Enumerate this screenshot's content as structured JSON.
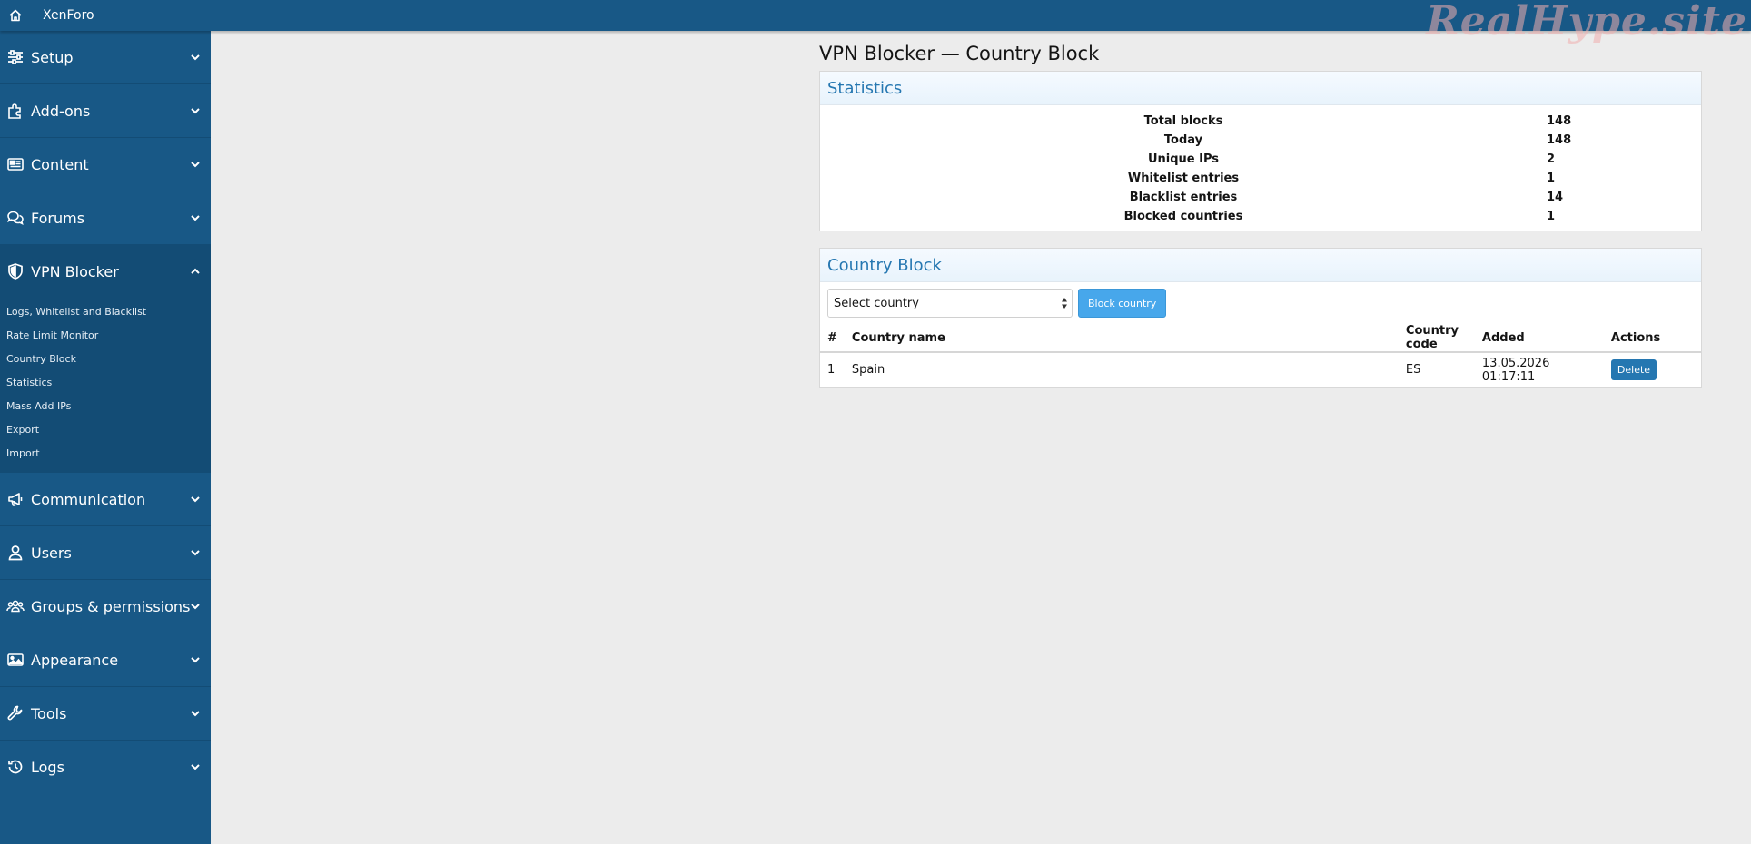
{
  "topbar": {
    "brand": "XenForo",
    "watermark": "RealHype.site"
  },
  "sidebar": {
    "sections": [
      {
        "label": "Setup",
        "icon": "sliders-icon"
      },
      {
        "label": "Add-ons",
        "icon": "puzzle-icon"
      },
      {
        "label": "Content",
        "icon": "newspaper-icon"
      },
      {
        "label": "Forums",
        "icon": "comments-icon"
      },
      {
        "label": "VPN Blocker",
        "icon": "shield-icon",
        "open": true,
        "items": [
          "Logs, Whitelist and Blacklist",
          "Rate Limit Monitor",
          "Country Block",
          "Statistics",
          "Mass Add IPs",
          "Export",
          "Import"
        ]
      },
      {
        "label": "Communication",
        "icon": "megaphone-icon"
      },
      {
        "label": "Users",
        "icon": "user-icon"
      },
      {
        "label": "Groups & permissions",
        "icon": "users-icon"
      },
      {
        "label": "Appearance",
        "icon": "image-icon"
      },
      {
        "label": "Tools",
        "icon": "wrench-icon"
      },
      {
        "label": "Logs",
        "icon": "history-icon"
      }
    ]
  },
  "main": {
    "title": "VPN Blocker — Country Block",
    "statistics": {
      "heading": "Statistics",
      "rows": [
        {
          "label": "Total blocks",
          "value": "148"
        },
        {
          "label": "Today",
          "value": "148"
        },
        {
          "label": "Unique IPs",
          "value": "2"
        },
        {
          "label": "Whitelist entries",
          "value": "1"
        },
        {
          "label": "Blacklist entries",
          "value": "14"
        },
        {
          "label": "Blocked countries",
          "value": "1"
        }
      ]
    },
    "country_block": {
      "heading": "Country Block",
      "select_value": "Select country",
      "block_button": "Block country",
      "columns": [
        "#",
        "Country name",
        "Country code",
        "Added",
        "Actions"
      ],
      "rows": [
        {
          "num": "1",
          "name": "Spain",
          "code": "ES",
          "added": "13.05.2026 01:17:11",
          "action": "Delete"
        }
      ]
    }
  },
  "colors": {
    "sidebar": "#185886",
    "sidebar_open": "#134c75",
    "accent": "#2577b1",
    "button": "#47a7eb"
  }
}
